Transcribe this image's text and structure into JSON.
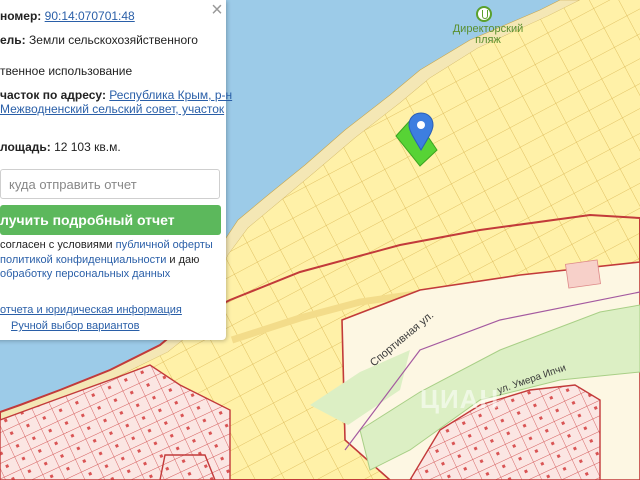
{
  "map": {
    "poi_label_line1": "Директорский",
    "poi_label_line2": "пляж",
    "street_1": "Спортивная ул.",
    "street_2": "ул. Умера Ипчи",
    "watermark": "ЦИАН",
    "colors": {
      "water": "#9ccbe8",
      "land": "#fdf3c8",
      "parcel_fill": "#fff1a8",
      "parcel_line": "#d9b450",
      "zone_border": "#c23a3a",
      "selected_parcel": "#57d335",
      "marker": "#3d7ee0",
      "park": "#dcefc4"
    }
  },
  "panel": {
    "cadastral_label": "номер:",
    "cadastral_value": "90:14:070701:48",
    "category_label": "ель:",
    "category_value": "Земли сельскохозяйственного",
    "usage_value": "твенное использование",
    "address_label": "часток по адресу:",
    "address_line1": "Республика Крым, р-н",
    "address_line2": "Межводненский сельский совет, участок",
    "area_label": "лощадь:",
    "area_value": "12 103 кв.м.",
    "email_placeholder": "куда отправить отчет",
    "report_button": "лучить подробный отчет",
    "consent_line1_prefix": "согласен с условиями ",
    "consent_line1_link": "публичной оферты",
    "consent_line2_prefix": "",
    "consent_line2_link": "политикой конфиденциальности",
    "consent_line2_suffix": " и даю",
    "consent_line3_link": "обработку персональных данных",
    "example_link": "отчета и юридическая информация",
    "manual_link": "Ручной выбор вариантов"
  }
}
